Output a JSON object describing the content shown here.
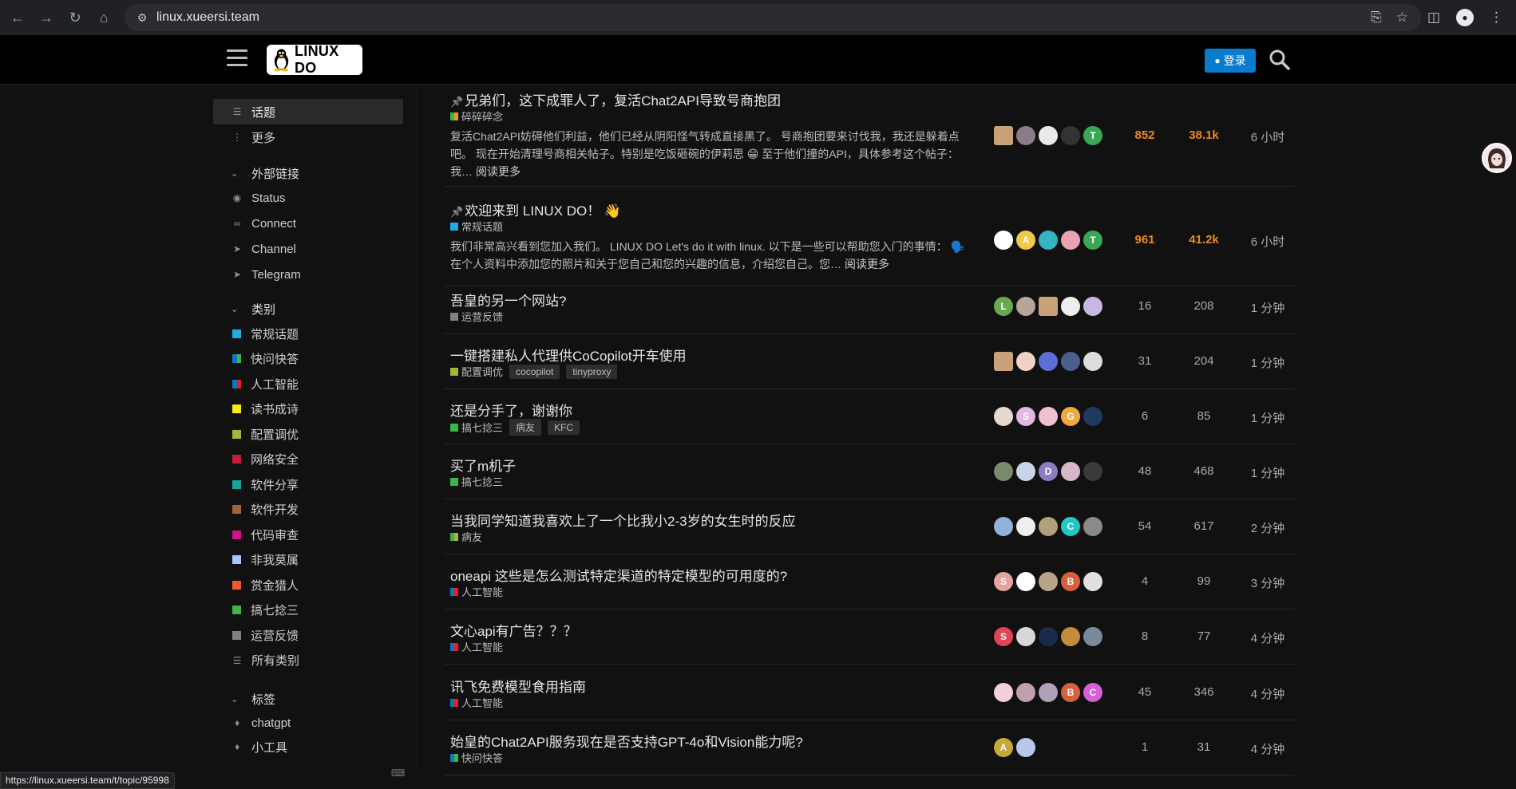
{
  "browser": {
    "url": "linux.xueersi.team",
    "status_url": "https://linux.xueersi.team/t/topic/95998"
  },
  "header": {
    "logo_text": "LINUX DO",
    "login_label": "登录"
  },
  "sidebar": {
    "top_items": [
      {
        "label": "话题",
        "icon": "layers-icon"
      },
      {
        "label": "更多",
        "icon": "more-vertical-icon"
      }
    ],
    "links_section": {
      "title": "外部链接",
      "items": [
        {
          "label": "Status",
          "icon": "eye-icon"
        },
        {
          "label": "Connect",
          "icon": "link-icon"
        },
        {
          "label": "Channel",
          "icon": "send-icon"
        },
        {
          "label": "Telegram",
          "icon": "send-icon"
        }
      ]
    },
    "categories_section": {
      "title": "类别",
      "items": [
        {
          "label": "常规话题",
          "color": "#25AAE2"
        },
        {
          "label": "快问快答",
          "color": "#0E76BD",
          "color2": "#3AB54A"
        },
        {
          "label": "人工智能",
          "color": "#0E76BD",
          "color2": "#ED1C24"
        },
        {
          "label": "读书成诗",
          "color": "#F7EA0F"
        },
        {
          "label": "配置调优",
          "color": "#9EB83B"
        },
        {
          "label": "网络安全",
          "color": "#C41E3A"
        },
        {
          "label": "软件分享",
          "color": "#12A89D"
        },
        {
          "label": "软件开发",
          "color": "#A0643B"
        },
        {
          "label": "代码审查",
          "color": "#D3128C"
        },
        {
          "label": "非我莫属",
          "color": "#A8C6FE"
        },
        {
          "label": "赏金猎人",
          "color": "#F15A29"
        },
        {
          "label": "搞七捻三",
          "color": "#3AB54A"
        },
        {
          "label": "运营反馈",
          "color": "#808281"
        },
        {
          "label": "所有类别",
          "icon": "list-icon"
        }
      ]
    },
    "tags_section": {
      "title": "标签",
      "items": [
        {
          "label": "chatgpt",
          "icon": "tag-icon"
        },
        {
          "label": "小工具",
          "icon": "tag-icon"
        }
      ]
    }
  },
  "topics": [
    {
      "title": "兄弟们，这下成罪人了，复活Chat2API导致号商抱团",
      "pinned": true,
      "category": "碎碎碎念",
      "cat_color": "#3AB54A",
      "cat_color2": "#F7941D",
      "excerpt": "复活Chat2API妨碍他们利益，他们已经从阴阳怪气转成直接黑了。 号商抱团要来讨伐我，我还是躲着点吧。 现在开始清理号商相关帖子。特别是吃饭砸碗的伊莉思 😁 至于他们撞的API，具体参考这个帖子： 我…",
      "more": "阅读更多",
      "replies": "852",
      "views": "38.1k",
      "activity": "6 小时",
      "hot": true,
      "avatars": [
        {
          "c": "#c9a27a",
          "t": "",
          "sq": true
        },
        {
          "c": "#8a7c88",
          "t": ""
        },
        {
          "c": "#e9e9e9",
          "t": ""
        },
        {
          "c": "#333333",
          "t": ""
        },
        {
          "c": "#3aa757",
          "t": "T"
        }
      ]
    },
    {
      "title": "欢迎来到 LINUX DO！ 👋",
      "pinned": true,
      "category": "常规话题",
      "cat_color": "#25AAE2",
      "excerpt": "我们非常高兴看到您加入我们。 LINUX DO Let's do it with linux. 以下是一些可以帮助您入门的事情： 🗣️ 在个人资料中添加您的照片和关于您自己和您的兴趣的信息，介绍您自己。您…",
      "more": "阅读更多",
      "replies": "961",
      "views": "41.2k",
      "activity": "6 小时",
      "hot": true,
      "avatars": [
        {
          "c": "#ffffff",
          "t": ""
        },
        {
          "c": "#f2c84b",
          "t": "A"
        },
        {
          "c": "#33b5c5",
          "t": ""
        },
        {
          "c": "#e9a3b0",
          "t": ""
        },
        {
          "c": "#3aa757",
          "t": "T"
        }
      ]
    },
    {
      "title": "吾皇的另一个网站?",
      "category": "运营反馈",
      "cat_color": "#808281",
      "replies": "16",
      "views": "208",
      "activity": "1 分钟",
      "avatars": [
        {
          "c": "#6aa84f",
          "t": "L"
        },
        {
          "c": "#b7a59a",
          "t": ""
        },
        {
          "c": "#c9a27a",
          "t": "",
          "sq": true
        },
        {
          "c": "#eeeeee",
          "t": ""
        },
        {
          "c": "#c6b8e3",
          "t": ""
        }
      ]
    },
    {
      "title": "一键搭建私人代理供CoCopilot开车使用",
      "category": "配置调优",
      "cat_color": "#9EB83B",
      "tags": [
        "cocopilot",
        "tinyproxy"
      ],
      "replies": "31",
      "views": "204",
      "activity": "1 分钟",
      "avatars": [
        {
          "c": "#c9a27a",
          "t": "",
          "sq": true
        },
        {
          "c": "#f1d3c4",
          "t": ""
        },
        {
          "c": "#5b6fd4",
          "t": ""
        },
        {
          "c": "#4a5f8c",
          "t": ""
        },
        {
          "c": "#dddddd",
          "t": ""
        }
      ]
    },
    {
      "title": "还是分手了，谢谢你",
      "category": "搞七捻三",
      "cat_color": "#3AB54A",
      "tags": [
        "病友",
        "KFC"
      ],
      "replies": "6",
      "views": "85",
      "activity": "1 分钟",
      "avatars": [
        {
          "c": "#e8d9cf",
          "t": ""
        },
        {
          "c": "#e2b8e0",
          "t": "S"
        },
        {
          "c": "#f0c0d0",
          "t": ""
        },
        {
          "c": "#f2a93b",
          "t": "G"
        },
        {
          "c": "#1f3a5f",
          "t": ""
        }
      ]
    },
    {
      "title": "买了m机子",
      "category": "搞七捻三",
      "cat_color": "#3AB54A",
      "replies": "48",
      "views": "468",
      "activity": "1 分钟",
      "avatars": [
        {
          "c": "#7a8a6a",
          "t": ""
        },
        {
          "c": "#c8d4e8",
          "t": ""
        },
        {
          "c": "#8e7cc3",
          "t": "D"
        },
        {
          "c": "#d7b8c8",
          "t": ""
        },
        {
          "c": "#3a3a3a",
          "t": ""
        }
      ]
    },
    {
      "title": "当我同学知道我喜欢上了一个比我小2-3岁的女生时的反应",
      "category": "病友",
      "cat_color": "#3AB54A",
      "cat_color2": "#9EB83B",
      "replies": "54",
      "views": "617",
      "activity": "2 分钟",
      "avatars": [
        {
          "c": "#8fb3d9",
          "t": ""
        },
        {
          "c": "#eeeeee",
          "t": ""
        },
        {
          "c": "#b3a07a",
          "t": ""
        },
        {
          "c": "#1fc7c7",
          "t": "C"
        },
        {
          "c": "#8a8a8a",
          "t": ""
        }
      ]
    },
    {
      "title": "oneapi 这些是怎么测试特定渠道的特定模型的可用度的?",
      "category": "人工智能",
      "cat_color": "#0E76BD",
      "cat_color2": "#ED1C24",
      "replies": "4",
      "views": "99",
      "activity": "3 分钟",
      "avatars": [
        {
          "c": "#e6a3a0",
          "t": "S"
        },
        {
          "c": "#ffffff",
          "t": ""
        },
        {
          "c": "#b9a48a",
          "t": ""
        },
        {
          "c": "#d9603b",
          "t": "B"
        },
        {
          "c": "#e0e0e0",
          "t": ""
        }
      ]
    },
    {
      "title": "文心api有广告？？？",
      "category": "人工智能",
      "cat_color": "#0E76BD",
      "cat_color2": "#ED1C24",
      "replies": "8",
      "views": "77",
      "activity": "4 分钟",
      "avatars": [
        {
          "c": "#e0455a",
          "t": "S"
        },
        {
          "c": "#d8d8d8",
          "t": ""
        },
        {
          "c": "#1a2a4a",
          "t": ""
        },
        {
          "c": "#c58a3a",
          "t": ""
        },
        {
          "c": "#7a8a9a",
          "t": ""
        }
      ]
    },
    {
      "title": "讯飞免费模型食用指南",
      "category": "人工智能",
      "cat_color": "#0E76BD",
      "cat_color2": "#ED1C24",
      "replies": "45",
      "views": "346",
      "activity": "4 分钟",
      "avatars": [
        {
          "c": "#f4d0dc",
          "t": ""
        },
        {
          "c": "#c0a0b0",
          "t": ""
        },
        {
          "c": "#b0a0b8",
          "t": ""
        },
        {
          "c": "#d9603b",
          "t": "B"
        },
        {
          "c": "#d65fd6",
          "t": "C"
        }
      ]
    },
    {
      "title": "始皇的Chat2API服务现在是否支持GPT-4o和Vision能力呢?",
      "category": "快问快答",
      "cat_color": "#0E76BD",
      "cat_color2": "#3AB54A",
      "replies": "1",
      "views": "31",
      "activity": "4 分钟",
      "avatars": [
        {
          "c": "#c8a83a",
          "t": "A"
        },
        {
          "c": "#b8c8e8",
          "t": ""
        }
      ]
    }
  ]
}
